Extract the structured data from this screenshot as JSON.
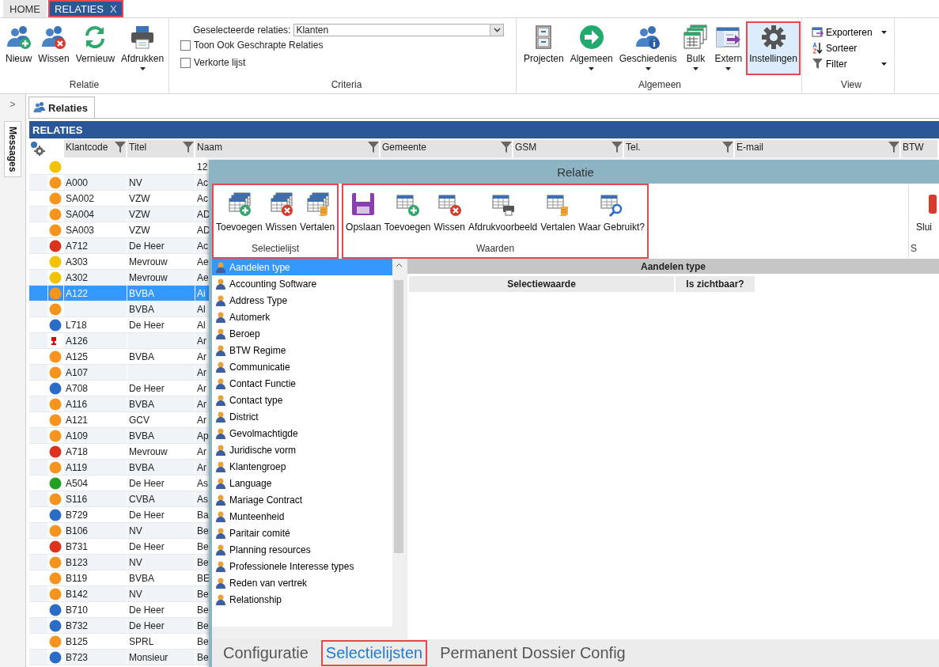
{
  "tabs": [
    {
      "label": "HOME",
      "selected": false,
      "highlighted": false
    },
    {
      "label": "RELATIES",
      "selected": true,
      "highlighted": true,
      "close": "X"
    }
  ],
  "ribbon": {
    "relatie": {
      "label": "Relatie",
      "buttons": [
        {
          "label": "Nieuw",
          "dropdown": false
        },
        {
          "label": "Wissen",
          "dropdown": false
        },
        {
          "label": "Vernieuw",
          "dropdown": false
        },
        {
          "label": "Afdrukken",
          "dropdown": true
        }
      ]
    },
    "criteria": {
      "label": "Criteria",
      "select_label": "Geselecteerde relaties:",
      "select_value": "Klanten",
      "checkboxes": [
        {
          "label": "Toon Ook Geschrapte Relaties",
          "checked": false
        },
        {
          "label": "Verkorte lijst",
          "checked": false
        }
      ]
    },
    "algemeen": {
      "label": "Algemeen",
      "buttons": [
        {
          "label": "Projecten",
          "dropdown": false,
          "highlighted": false
        },
        {
          "label": "Algemeen",
          "dropdown": true,
          "highlighted": false
        },
        {
          "label": "Geschiedenis",
          "dropdown": true,
          "highlighted": false
        },
        {
          "label": "Bulk",
          "dropdown": true,
          "highlighted": false
        },
        {
          "label": "Extern",
          "dropdown": true,
          "highlighted": false
        },
        {
          "label": "Instellingen",
          "dropdown": false,
          "highlighted": true
        }
      ]
    },
    "view": {
      "label": "View",
      "items": [
        {
          "label": "Exporteren",
          "dropdown": true
        },
        {
          "label": "Sorteer",
          "dropdown": false
        },
        {
          "label": "Filter",
          "dropdown": true
        }
      ]
    }
  },
  "sidebar": {
    "toggle": ">",
    "label": "Messages"
  },
  "document_tab": {
    "label": "Relaties"
  },
  "grid": {
    "title": "RELATIES",
    "columns": [
      {
        "label": "Klantcode",
        "filter": true
      },
      {
        "label": "Titel",
        "filter": true
      },
      {
        "label": "Naam",
        "filter": true
      },
      {
        "label": "Gemeente",
        "filter": true
      },
      {
        "label": "GSM",
        "filter": true
      },
      {
        "label": "Tel.",
        "filter": true
      },
      {
        "label": "E-mail",
        "filter": true
      },
      {
        "label": "BTW",
        "filter": false
      }
    ],
    "rows": [
      {
        "kind": "dot",
        "color": "#f2c200",
        "naam": "12",
        "selected": false
      },
      {
        "kind": "dot",
        "color": "#f7941d",
        "code": "A000",
        "titel": "NV",
        "naam": "Ac",
        "selected": false
      },
      {
        "kind": "dot",
        "color": "#f7941d",
        "code": "SA002",
        "titel": "VZW",
        "naam": "Ac",
        "selected": false
      },
      {
        "kind": "dot",
        "color": "#f7941d",
        "code": "SA004",
        "titel": "VZW",
        "naam": "AD",
        "selected": false
      },
      {
        "kind": "dot",
        "color": "#f7941d",
        "code": "SA003",
        "titel": "VZW",
        "naam": "AD",
        "selected": false
      },
      {
        "kind": "dot",
        "color": "#e0301e",
        "code": "A712",
        "titel": "De Heer",
        "naam": "Ac",
        "selected": false
      },
      {
        "kind": "dot",
        "color": "#f2c200",
        "code": "A303",
        "titel": "Mevrouw",
        "naam": "Ae",
        "selected": false
      },
      {
        "kind": "dot",
        "color": "#f2c200",
        "code": "A302",
        "titel": "Mevrouw",
        "naam": "Ae",
        "selected": false
      },
      {
        "kind": "dot",
        "color": "#f7941d",
        "code": "A122",
        "titel": "BVBA",
        "naam": "Ai",
        "selected": true
      },
      {
        "kind": "dot",
        "color": "#f7941d",
        "titel": "BVBA",
        "naam": "Al",
        "selected": false
      },
      {
        "kind": "dot",
        "color": "#2a6cc8",
        "code": "L718",
        "titel": "De Heer",
        "naam": "Al",
        "selected": false
      },
      {
        "kind": "flag",
        "color": "#e00000",
        "code": "A126",
        "naam": "Ar",
        "selected": false
      },
      {
        "kind": "dot",
        "color": "#f7941d",
        "code": "A125",
        "titel": "BVBA",
        "naam": "Ar",
        "selected": false
      },
      {
        "kind": "dot",
        "color": "#f7941d",
        "code": "A107",
        "naam": "Ar",
        "selected": false
      },
      {
        "kind": "dot",
        "color": "#2a6cc8",
        "code": "A708",
        "titel": "De Heer",
        "naam": "Ar",
        "selected": false
      },
      {
        "kind": "dot",
        "color": "#f7941d",
        "code": "A116",
        "titel": "BVBA",
        "naam": "Ar",
        "selected": false
      },
      {
        "kind": "dot",
        "color": "#f7941d",
        "code": "A121",
        "titel": "GCV",
        "naam": "Ar",
        "selected": false
      },
      {
        "kind": "dot",
        "color": "#f7941d",
        "code": "A109",
        "titel": "BVBA",
        "naam": "Ap",
        "selected": false
      },
      {
        "kind": "dot",
        "color": "#e0301e",
        "code": "A718",
        "titel": "Mevrouw",
        "naam": "Ar",
        "selected": false
      },
      {
        "kind": "dot",
        "color": "#f7941d",
        "code": "A119",
        "titel": "BVBA",
        "naam": "Ar",
        "selected": false
      },
      {
        "kind": "dot",
        "color": "#22a022",
        "code": "A504",
        "titel": "De Heer",
        "naam": "As",
        "selected": false
      },
      {
        "kind": "dot",
        "color": "#f7941d",
        "code": "S116",
        "titel": "CVBA",
        "naam": "As",
        "selected": false
      },
      {
        "kind": "dot",
        "color": "#2a6cc8",
        "code": "B729",
        "titel": "De Heer",
        "naam": "Ba",
        "selected": false
      },
      {
        "kind": "dot",
        "color": "#f7941d",
        "code": "B106",
        "titel": "NV",
        "naam": "Be",
        "selected": false
      },
      {
        "kind": "dot",
        "color": "#e0301e",
        "code": "B731",
        "titel": "De Heer",
        "naam": "Be",
        "selected": false
      },
      {
        "kind": "dot",
        "color": "#f7941d",
        "code": "B123",
        "titel": "NV",
        "naam": "Be",
        "selected": false
      },
      {
        "kind": "dot",
        "color": "#f7941d",
        "code": "B119",
        "titel": "BVBA",
        "naam": "BE",
        "selected": false
      },
      {
        "kind": "dot",
        "color": "#f7941d",
        "code": "B142",
        "titel": "NV",
        "naam": "Be",
        "selected": false
      },
      {
        "kind": "dot",
        "color": "#2a6cc8",
        "code": "B710",
        "titel": "De Heer",
        "naam": "Be",
        "selected": false
      },
      {
        "kind": "dot",
        "color": "#2a6cc8",
        "code": "B732",
        "titel": "De Heer",
        "naam": "Be",
        "selected": false
      },
      {
        "kind": "dot",
        "color": "#f7941d",
        "code": "B125",
        "titel": "SPRL",
        "naam": "Be",
        "selected": false
      },
      {
        "kind": "dot",
        "color": "#2a6cc8",
        "code": "B723",
        "titel": "Monsieur",
        "naam": "Be",
        "selected": false
      }
    ]
  },
  "dialog": {
    "title": "Relatie",
    "groups": [
      {
        "label": "Selectielijst",
        "highlighted": true,
        "buttons": [
          {
            "label": "Toevoegen"
          },
          {
            "label": "Wissen"
          },
          {
            "label": "Vertalen"
          }
        ]
      },
      {
        "label": "Waarden",
        "highlighted": true,
        "buttons": [
          {
            "label": "Opslaan"
          },
          {
            "label": "Toevoegen"
          },
          {
            "label": "Wissen"
          },
          {
            "label": "Afdrukvoorbeeld"
          },
          {
            "label": "Vertalen"
          },
          {
            "label": "Waar Gebruikt?"
          }
        ]
      },
      {
        "label": "S",
        "highlighted": false,
        "buttons": [
          {
            "label": "Slui"
          }
        ]
      }
    ],
    "list": [
      {
        "label": "Aandelen type",
        "selected": true
      },
      {
        "label": "Accounting Software",
        "selected": false
      },
      {
        "label": "Address Type",
        "selected": false
      },
      {
        "label": "Automerk",
        "selected": false
      },
      {
        "label": "Beroep",
        "selected": false
      },
      {
        "label": "BTW Regime",
        "selected": false
      },
      {
        "label": "Communicatie",
        "selected": false
      },
      {
        "label": "Contact Functie",
        "selected": false
      },
      {
        "label": "Contact type",
        "selected": false
      },
      {
        "label": "District",
        "selected": false
      },
      {
        "label": "Gevolmachtigde",
        "selected": false
      },
      {
        "label": "Juridische vorm",
        "selected": false
      },
      {
        "label": "Klantengroep",
        "selected": false
      },
      {
        "label": "Language",
        "selected": false
      },
      {
        "label": "Mariage Contract",
        "selected": false
      },
      {
        "label": "Munteenheid",
        "selected": false
      },
      {
        "label": "Paritair comité",
        "selected": false
      },
      {
        "label": "Planning resources",
        "selected": false
      },
      {
        "label": "Professionele Interesse types",
        "selected": false
      },
      {
        "label": "Reden van vertrek",
        "selected": false
      },
      {
        "label": "Relationship",
        "selected": false
      }
    ],
    "detail": {
      "title": "Aandelen type",
      "columns": [
        "Selectiewaarde",
        "Is zichtbaar?"
      ]
    },
    "bottom_tabs": [
      {
        "label": "Configuratie",
        "selected": false,
        "highlighted": false
      },
      {
        "label": "Selectielijsten",
        "selected": true,
        "highlighted": true
      },
      {
        "label": "Permanent Dossier Config",
        "selected": false,
        "highlighted": false
      }
    ]
  }
}
